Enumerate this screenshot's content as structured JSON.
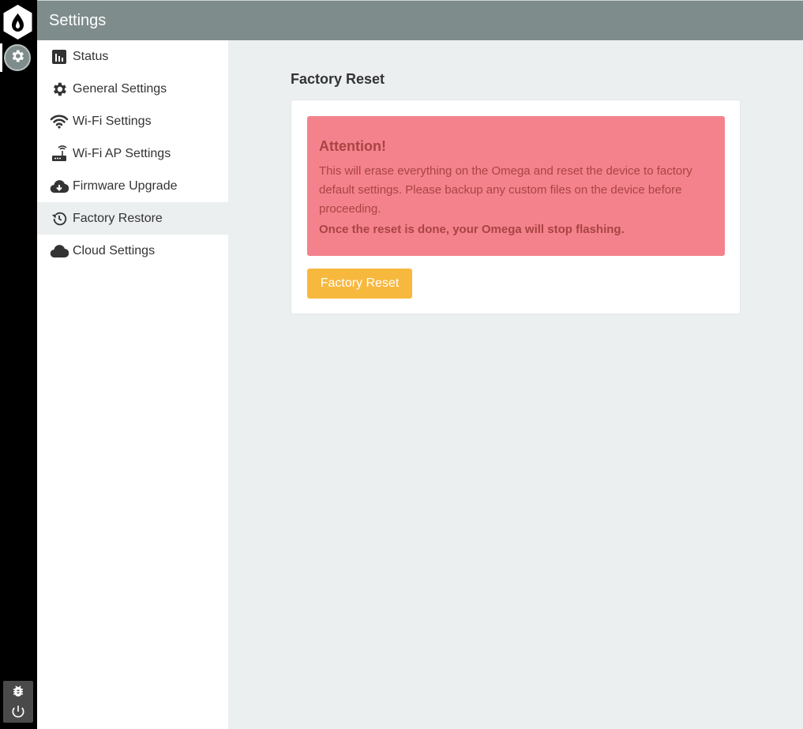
{
  "header": {
    "title": "Settings"
  },
  "rail": {
    "logo_icon": "omega-logo-icon",
    "app_icon": "gear-icon",
    "bottom_icons": [
      "bug-icon",
      "power-icon"
    ]
  },
  "sidebar": {
    "items": [
      {
        "label": "Status",
        "icon": "bar-chart-icon",
        "active": false
      },
      {
        "label": "General Settings",
        "icon": "gear-icon",
        "active": false
      },
      {
        "label": "Wi-Fi Settings",
        "icon": "wifi-icon",
        "active": false
      },
      {
        "label": "Wi-Fi AP Settings",
        "icon": "router-icon",
        "active": false
      },
      {
        "label": "Firmware Upgrade",
        "icon": "cloud-download-icon",
        "active": false
      },
      {
        "label": "Factory Restore",
        "icon": "history-icon",
        "active": true
      },
      {
        "label": "Cloud Settings",
        "icon": "cloud-icon",
        "active": false
      }
    ]
  },
  "main": {
    "title": "Factory Reset",
    "alert": {
      "heading": "Attention!",
      "body": "This will erase everything on the Omega and reset the device to factory default settings. Please backup any custom files on the device before proceeding.",
      "strong": "Once the reset is done, your Omega will stop flashing."
    },
    "button_label": "Factory Reset"
  },
  "colors": {
    "header_bg": "#7f8c8c",
    "rail_bg": "#000000",
    "alert_bg": "#f4828d",
    "alert_text": "#a94442",
    "button_bg": "#f7b83e",
    "content_bg": "#eceff0"
  }
}
